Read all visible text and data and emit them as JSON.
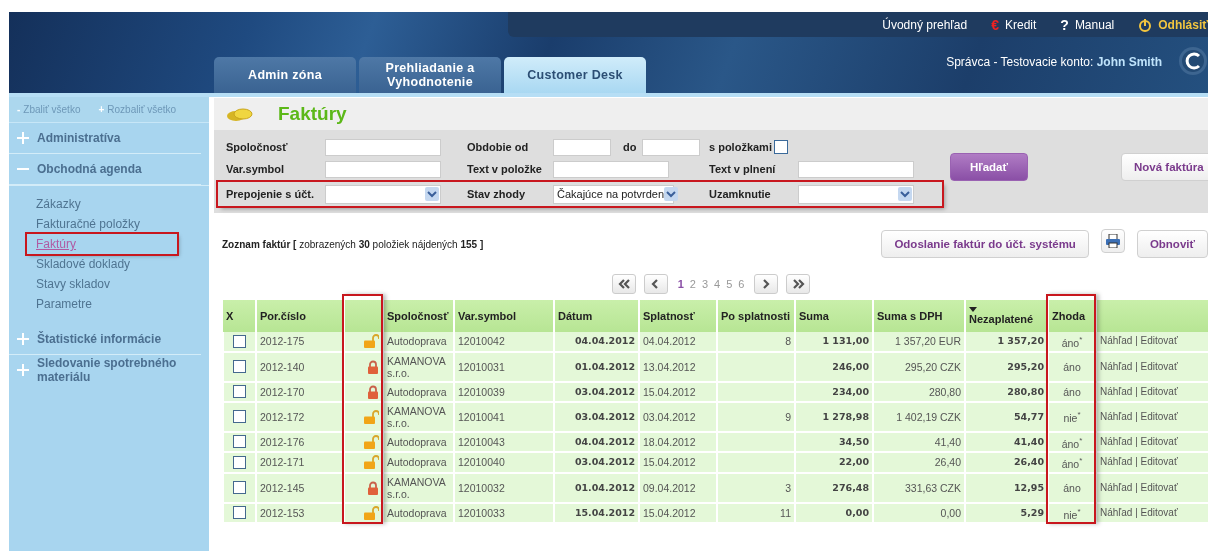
{
  "top_links": [
    {
      "label": "Úvodný prehľad",
      "kind": "plain"
    },
    {
      "label": "Kredit",
      "icon": "€",
      "kind": "euro"
    },
    {
      "label": "Manual",
      "icon": "?",
      "kind": "help"
    },
    {
      "label": "Odhlásiť",
      "kind": "logout"
    }
  ],
  "tabs": [
    {
      "label": "Admin zóna",
      "selected": false
    },
    {
      "label": "Prehliadanie a Vyhodnotenie",
      "selected": false
    },
    {
      "label": "Customer Desk",
      "selected": true
    }
  ],
  "user": "Správca - Testovacie konto: **John Smith**",
  "sidebar": {
    "tools": [
      {
        "symbol": "-",
        "label": "Zbaliť všetko"
      },
      {
        "symbol": "+",
        "label": "Rozbaliť všetko"
      }
    ],
    "sections": [
      {
        "label": "Administratíva",
        "expanded": false
      },
      {
        "label": "Obchodná agenda",
        "expanded": true,
        "children": [
          {
            "label": "Zákazky",
            "selected": false,
            "highlighted": false
          },
          {
            "label": "Fakturačné položky",
            "selected": false,
            "highlighted": false
          },
          {
            "label": "Faktúry",
            "selected": true,
            "highlighted": true
          },
          {
            "label": "Skladové doklady",
            "selected": false,
            "highlighted": false
          },
          {
            "label": "Stavy skladov",
            "selected": false,
            "highlighted": false
          },
          {
            "label": "Parametre",
            "selected": false,
            "highlighted": false
          }
        ]
      },
      {
        "label": "Štatistické informácie",
        "expanded": false
      },
      {
        "label": "Sledovanie spotrebného materiálu",
        "expanded": false
      }
    ]
  },
  "page_title": "Faktúry",
  "filters": {
    "rows": [
      {
        "highlighted": false,
        "fields": [
          {
            "kind": "text",
            "label": "Spoločnosť"
          },
          {
            "kind": "range",
            "label": "Obdobie od",
            "to_label": "do"
          },
          {
            "kind": "checkbox",
            "label": "s položkami",
            "checked": false
          }
        ]
      },
      {
        "highlighted": false,
        "fields": [
          {
            "kind": "text",
            "label": "Var.symbol"
          },
          {
            "kind": "text",
            "label": "Text v položke"
          },
          {
            "kind": "text",
            "label": "Text v plnení"
          }
        ]
      },
      {
        "highlighted": true,
        "fields": [
          {
            "kind": "select",
            "label": "Prepojenie s účt."
          },
          {
            "kind": "select",
            "label": "Stav zhody",
            "value": "Čakajúce na potvrden"
          },
          {
            "kind": "select",
            "label": "Uzamknutie"
          }
        ]
      }
    ],
    "buttons": [
      {
        "label": "Hľadať",
        "kind": "primary"
      },
      {
        "label": "Nová faktúra",
        "kind": "default"
      }
    ]
  },
  "list_summary": "**Zoznam faktúr [** zobrazených **30** položiek nájdených **155 ]**",
  "list_buttons": [
    {
      "label": "Odoslanie faktúr do účt. systému",
      "kind": "text"
    },
    {
      "kind": "print"
    },
    {
      "label": "Obnoviť",
      "kind": "text"
    }
  ],
  "pagination": {
    "pages": [
      {
        "label": "1",
        "selected": true
      },
      {
        "label": "2",
        "selected": false
      },
      {
        "label": "3",
        "selected": false
      },
      {
        "label": "4",
        "selected": false
      },
      {
        "label": "5",
        "selected": false
      },
      {
        "label": "6",
        "selected": false
      }
    ]
  },
  "table": {
    "columns": [
      {
        "kind": "check",
        "label": "X",
        "highlighted": false,
        "sorted": false
      },
      {
        "kind": "text",
        "label": "Por.číslo",
        "highlighted": false,
        "sorted": false
      },
      {
        "kind": "lock",
        "highlighted": true,
        "sorted": false
      },
      {
        "kind": "text",
        "label": "Spoločnosť",
        "highlighted": false,
        "sorted": false
      },
      {
        "kind": "text",
        "label": "Var.symbol",
        "highlighted": false,
        "sorted": false
      },
      {
        "kind": "text",
        "label": "Dátum",
        "highlighted": false,
        "sorted": false
      },
      {
        "kind": "text",
        "label": "Splatnosť",
        "highlighted": false,
        "sorted": false
      },
      {
        "kind": "text",
        "label": "Po splatnosti",
        "highlighted": false,
        "sorted": false
      },
      {
        "kind": "text",
        "label": "Suma",
        "highlighted": false,
        "sorted": false
      },
      {
        "kind": "text",
        "label": "Suma s DPH",
        "highlighted": false,
        "sorted": false
      },
      {
        "kind": "text",
        "label": "Nezaplatené",
        "highlighted": false,
        "sorted": true
      },
      {
        "kind": "text",
        "label": "Zhoda",
        "highlighted": true,
        "sorted": false
      },
      {
        "kind": "actions",
        "highlighted": false,
        "sorted": false
      }
    ],
    "rows": [
      {
        "selected": false,
        "number": "2012-175",
        "locked": false,
        "company": "Autodoprava",
        "var_symbol": "12010042",
        "date": "04.04.2012",
        "due": "04.04.2012",
        "overdue": "8",
        "amount": "1 131,00",
        "amount_vat": "1 357,20 EUR",
        "unpaid": "1 357,20",
        "match": "áno$^{*}$",
        "separator": "|",
        "actions": [
          "Náhľad",
          "Editovať"
        ]
      },
      {
        "selected": false,
        "number": "2012-140",
        "locked": true,
        "company": "KAMANOVA s.r.o.",
        "var_symbol": "12010031",
        "date": "01.04.2012",
        "due": "13.04.2012",
        "amount": "246,00",
        "amount_vat": "295,20 CZK",
        "unpaid": "295,20",
        "match": "áno",
        "separator": "|",
        "actions": [
          "Náhľad",
          "Editovať"
        ]
      },
      {
        "selected": false,
        "number": "2012-170",
        "locked": true,
        "company": "Autodoprava",
        "var_symbol": "12010039",
        "date": "03.04.2012",
        "due": "15.04.2012",
        "amount": "234,00",
        "amount_vat": "280,80",
        "unpaid": "280,80",
        "match": "áno",
        "separator": "|",
        "actions": [
          "Náhľad",
          "Editovať"
        ]
      },
      {
        "selected": false,
        "number": "2012-172",
        "locked": false,
        "company": "KAMANOVA s.r.o.",
        "var_symbol": "12010041",
        "date": "03.04.2012",
        "due": "03.04.2012",
        "overdue": "9",
        "amount": "1 278,98",
        "amount_vat": "1 402,19 CZK",
        "unpaid": "54,77",
        "match": "nie$^{*}$",
        "separator": "|",
        "actions": [
          "Náhľad",
          "Editovať"
        ]
      },
      {
        "selected": false,
        "number": "2012-176",
        "locked": false,
        "company": "Autodoprava",
        "var_symbol": "12010043",
        "date": "04.04.2012",
        "due": "18.04.2012",
        "amount": "34,50",
        "amount_vat": "41,40",
        "unpaid": "41,40",
        "match": "áno$^{*}$",
        "separator": "|",
        "actions": [
          "Náhľad",
          "Editovať"
        ]
      },
      {
        "selected": false,
        "number": "2012-171",
        "locked": false,
        "company": "Autodoprava",
        "var_symbol": "12010040",
        "date": "03.04.2012",
        "due": "15.04.2012",
        "amount": "22,00",
        "amount_vat": "26,40",
        "unpaid": "26,40",
        "match": "áno$^{*}$",
        "separator": "|",
        "actions": [
          "Náhľad",
          "Editovať"
        ]
      },
      {
        "selected": false,
        "number": "2012-145",
        "locked": true,
        "company": "KAMANOVA s.r.o.",
        "var_symbol": "12010032",
        "date": "01.04.2012",
        "due": "09.04.2012",
        "overdue": "3",
        "amount": "276,48",
        "amount_vat": "331,63 CZK",
        "unpaid": "12,95",
        "match": "áno",
        "separator": "|",
        "actions": [
          "Náhľad",
          "Editovať"
        ]
      },
      {
        "selected": false,
        "number": "2012-153",
        "locked": false,
        "company": "Autodoprava",
        "var_symbol": "12010033",
        "date": "15.04.2012",
        "due": "15.04.2012",
        "overdue": "11",
        "amount": "0,00",
        "amount_vat": "0,00",
        "unpaid": "5,29",
        "match": "nie$^{*}$",
        "separator": "|",
        "actions": [
          "Náhľad",
          "Editovať"
        ]
      }
    ]
  }
}
